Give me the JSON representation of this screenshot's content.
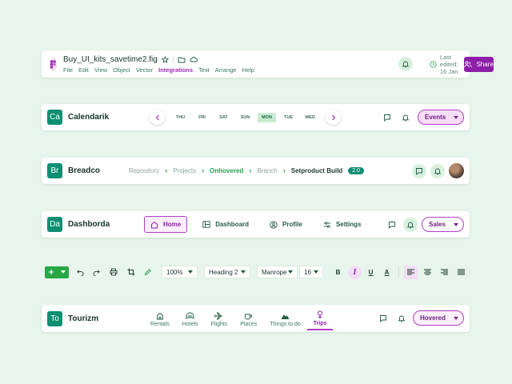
{
  "figma": {
    "filename": "Buy_UI_kits_savetime2.fig",
    "menu": [
      "File",
      "Edit",
      "View",
      "Object",
      "Vector",
      "Integrations",
      "Text",
      "Arrange",
      "Help"
    ],
    "active_menu": "Integrations",
    "last_edited": "Last edited: 16 Jan",
    "share_label": "Share"
  },
  "calendar": {
    "logo": "Ca",
    "title": "Calendarik",
    "days": [
      "THU",
      "FRI",
      "SAT",
      "SUN",
      "MON",
      "TUE",
      "WED"
    ],
    "selected_day": "MON",
    "dropdown": "Events"
  },
  "breadco": {
    "logo": "Br",
    "title": "Breadco",
    "crumbs": [
      "Repository",
      "Projects",
      "Onhovered",
      "Branch",
      "Setproduct Build"
    ],
    "version": "2.0"
  },
  "dashborda": {
    "logo": "Da",
    "title": "Dashborda",
    "tabs": [
      "Home",
      "Dashboard",
      "Profile",
      "Settings"
    ],
    "dropdown": "Sales"
  },
  "toolbar": {
    "zoom": "100%",
    "heading": "Heading 2",
    "font": "Manrope",
    "size": "16",
    "bold": "B",
    "italic": "I",
    "underline": "U",
    "color": "A"
  },
  "tourizm": {
    "logo": "To",
    "title": "Tourizm",
    "tabs": [
      "Rentals",
      "Hotels",
      "Flights",
      "Places",
      "Things to do",
      "Trips"
    ],
    "dropdown": "Hovered"
  },
  "colors": {
    "brand": "#0f8f72",
    "accent": "#8e1fa8",
    "green": "#28a745"
  }
}
